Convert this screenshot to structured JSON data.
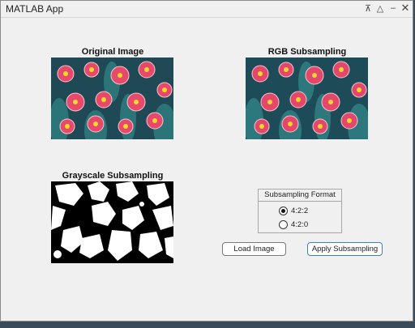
{
  "window": {
    "title": "MATLAB App",
    "controls": [
      "pin-icon",
      "expand-icon",
      "minimize-icon",
      "close-icon"
    ]
  },
  "panels": {
    "original_title": "Original Image",
    "rgb_title": "RGB Subsampling",
    "gray_title": "Grayscale Subsampling"
  },
  "subsampling": {
    "title": "Subsampling Format",
    "options": [
      {
        "label": "4:2:2",
        "selected": true
      },
      {
        "label": "4:2:0",
        "selected": false
      }
    ]
  },
  "buttons": {
    "load": "Load Image",
    "apply": "Apply Subsampling"
  },
  "colors": {
    "background": "#f0f0f0",
    "primary_button_border": "#3c7fd0"
  }
}
